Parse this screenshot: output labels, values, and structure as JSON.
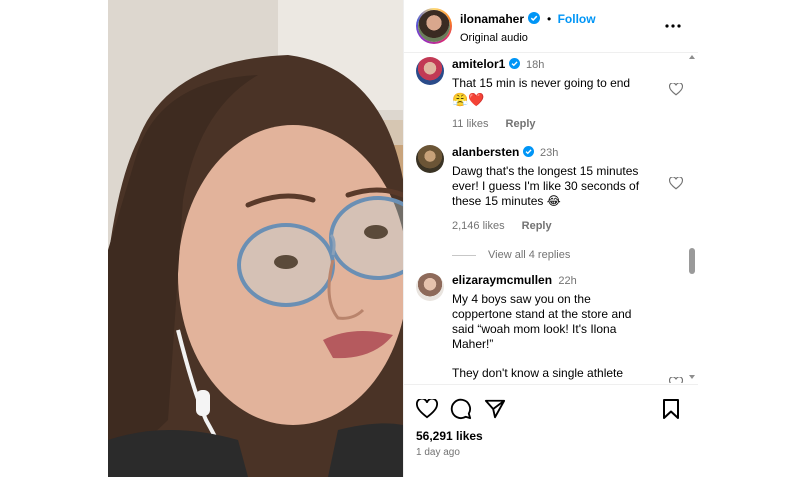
{
  "header": {
    "username": "ilonamaher",
    "separator": "•",
    "follow_label": "Follow",
    "audio": "Original audio",
    "more_icon": "more-horizontal-icon"
  },
  "comments": [
    {
      "username": "amitelor1",
      "time": "18h",
      "text": "That 15 min is never going to end",
      "emoji": "😤❤️",
      "likes": "11 likes",
      "reply_label": "Reply"
    },
    {
      "username": "alanbersten",
      "time": "23h",
      "text": "Dawg that's the longest 15 minutes ever! I guess I'm like 30 seconds of these 15 minutes 😂",
      "likes": "2,146 likes",
      "reply_label": "Reply",
      "view_replies": "View all 4 replies"
    },
    {
      "username": "elizaraymcmullen",
      "time": "22h",
      "text": "My 4 boys saw you on the coppertone stand at the store and said “woah mom look! It's Ilona Maher!”",
      "text2": "They don't know a single athlete"
    }
  ],
  "post": {
    "likes": "56,291 likes",
    "date": "1 day ago"
  },
  "colors": {
    "accent": "#0095f6",
    "muted": "#737373",
    "verified": "#0095f6"
  }
}
